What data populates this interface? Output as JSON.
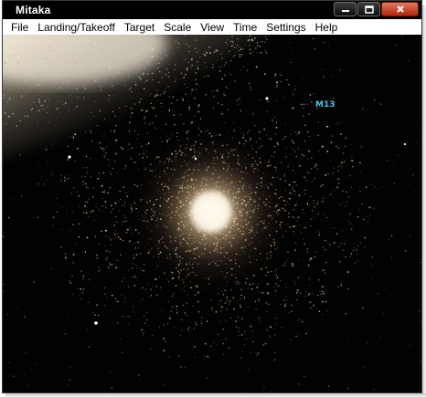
{
  "window": {
    "title": "Mitaka"
  },
  "menu": {
    "items": [
      "File",
      "Landing/Takeoff",
      "Target",
      "Scale",
      "View",
      "Time",
      "Settings",
      "Help"
    ]
  },
  "viewport": {
    "object_label": "M13",
    "label_color": "#4fc3e8"
  },
  "colors": {
    "background": "#000000",
    "star_tint": "#d9a77a",
    "close_button": "#c84a2f"
  }
}
